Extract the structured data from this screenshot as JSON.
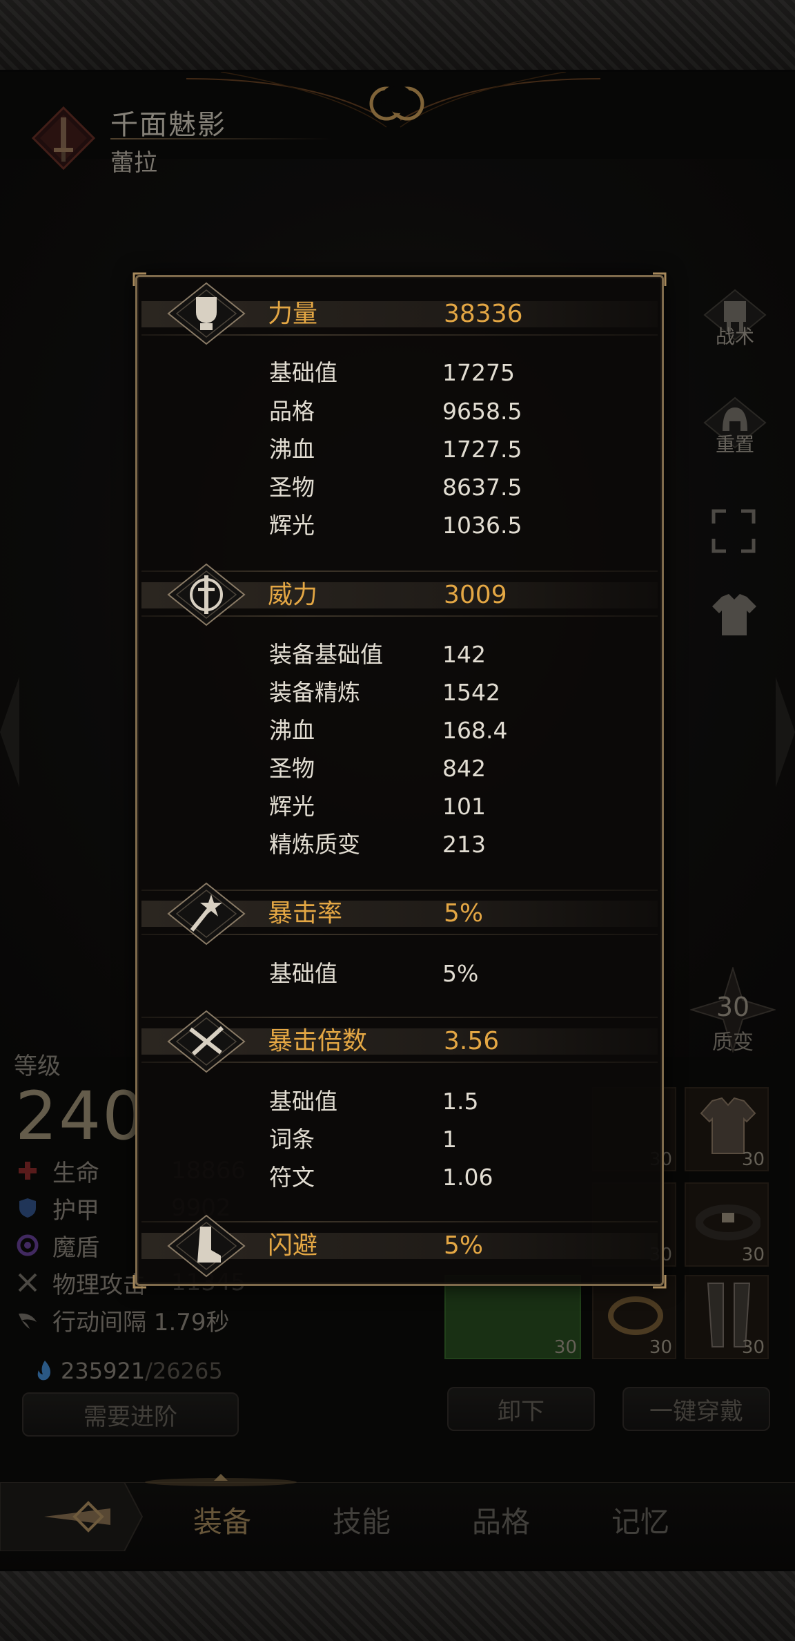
{
  "header": {
    "title": "千面魅影",
    "character_name": "蕾拉"
  },
  "side_buttons": {
    "tactics": "战术",
    "reset": "重置"
  },
  "quality": {
    "value": "30",
    "label": "质变"
  },
  "level": {
    "label": "等级",
    "value": "240"
  },
  "stats": [
    {
      "icon": "plus-cross-icon",
      "label": "生命",
      "value": "18866"
    },
    {
      "icon": "shield-icon",
      "label": "护甲",
      "value": "9902"
    },
    {
      "icon": "swirl-icon",
      "label": "魔盾",
      "value": ""
    },
    {
      "icon": "crossed-swords-icon",
      "label": "物理攻击",
      "value": "11345"
    },
    {
      "icon": "wing-icon",
      "label": "行动间隔 1.79秒",
      "value": ""
    }
  ],
  "soul": {
    "current": "235921",
    "required": "/26265"
  },
  "buttons": {
    "advance": "需要进阶",
    "unequip": "卸下",
    "equip_all": "一键穿戴"
  },
  "slots": [
    "30",
    "30",
    "30",
    "30",
    "30",
    "30",
    "30"
  ],
  "tabs": [
    "装备",
    "技能",
    "品格",
    "记忆"
  ],
  "panel": {
    "sections": [
      {
        "title": "力量",
        "total": "38336",
        "rows": [
          {
            "label": "基础值",
            "value": "17275"
          },
          {
            "label": "品格",
            "value": "9658.5"
          },
          {
            "label": "沸血",
            "value": "1727.5"
          },
          {
            "label": "圣物",
            "value": "8637.5"
          },
          {
            "label": "辉光",
            "value": "1036.5"
          }
        ]
      },
      {
        "title": "威力",
        "total": "3009",
        "rows": [
          {
            "label": "装备基础值",
            "value": "142"
          },
          {
            "label": "装备精炼",
            "value": "1542"
          },
          {
            "label": "沸血",
            "value": "168.4"
          },
          {
            "label": "圣物",
            "value": "842"
          },
          {
            "label": "辉光",
            "value": "101"
          },
          {
            "label": "精炼质变",
            "value": "213"
          }
        ]
      },
      {
        "title": "暴击率",
        "total": "5%",
        "rows": [
          {
            "label": "基础值",
            "value": "5%"
          }
        ]
      },
      {
        "title": "暴击倍数",
        "total": "3.56",
        "rows": [
          {
            "label": "基础值",
            "value": "1.5"
          },
          {
            "label": "词条",
            "value": "1"
          },
          {
            "label": "符文",
            "value": "1.06"
          }
        ]
      },
      {
        "title": "闪避",
        "total": "5%",
        "rows": []
      }
    ]
  },
  "colors": {
    "accent": "#e4a744",
    "panel_border": "#7f6b4c",
    "text": "#e2ddd2"
  }
}
